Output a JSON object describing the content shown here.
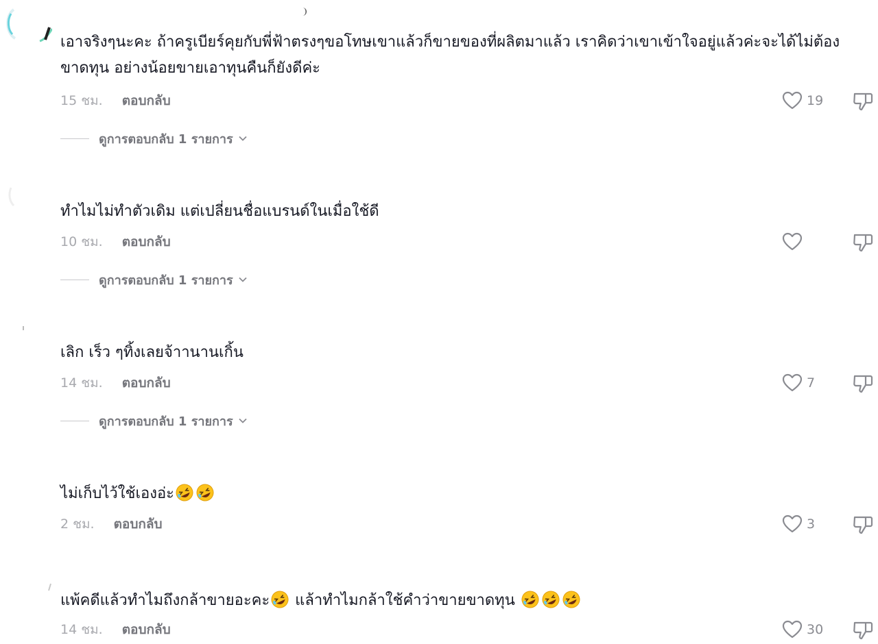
{
  "comments": [
    {
      "text": "เอาจริงๆนะคะ ถ้าครูเบียร์คุยกับพี่ฟ้าตรงๆขอโทษเขาแล้วก็ขายของที่ผลิตมาแล้ว เราคิดว่าเขาเข้าใจอยู่แล้วค่ะจะได้ไม่ต้องขาดทุน อย่างน้อยขายเอาทุนคืนก็ยังดีค่ะ",
      "time": "15 ชม.",
      "reply_label": "ตอบกลับ",
      "likes": "19",
      "view_replies": "ดูการตอบกลับ 1 รายการ"
    },
    {
      "text": "ทำไมไม่ทำตัวเดิม แต่เปลี่ยนชื่อแบรนด์ในเมื่อใช้ดี",
      "time": "10 ชม.",
      "reply_label": "ตอบกลับ",
      "likes": "",
      "view_replies": "ดูการตอบกลับ 1 รายการ"
    },
    {
      "text": "เลิก เร็ว ๆทิ้งเลยจ้าานานเกิ้น",
      "time": "14 ชม.",
      "reply_label": "ตอบกลับ",
      "likes": "7",
      "view_replies": "ดูการตอบกลับ 1 รายการ"
    },
    {
      "text": "ไม่เก็บไว้ใช้เองอ่ะ",
      "emoji_after": 2,
      "time": "2 ชม.",
      "reply_label": "ตอบกลับ",
      "likes": "3"
    },
    {
      "text_a": "แพ้คดีแล้วทำไมถึงกล้าขายอะคะ",
      "text_b": " แล้าทำไมกล้าใช้คำว่าขายขาดทุน ",
      "time": "14 ชม.",
      "reply_label": "ตอบกลับ",
      "likes": "30"
    }
  ],
  "icons": {
    "like": "heart-outline-icon",
    "dislike": "thumbs-down-icon",
    "expand": "chevron-down-icon",
    "emoji": "rolling-on-floor-laughing-emoji"
  },
  "colors": {
    "text": "#161823",
    "meta": "#a8a9ae",
    "reply": "#75767c",
    "icon": "#8a8b91"
  }
}
